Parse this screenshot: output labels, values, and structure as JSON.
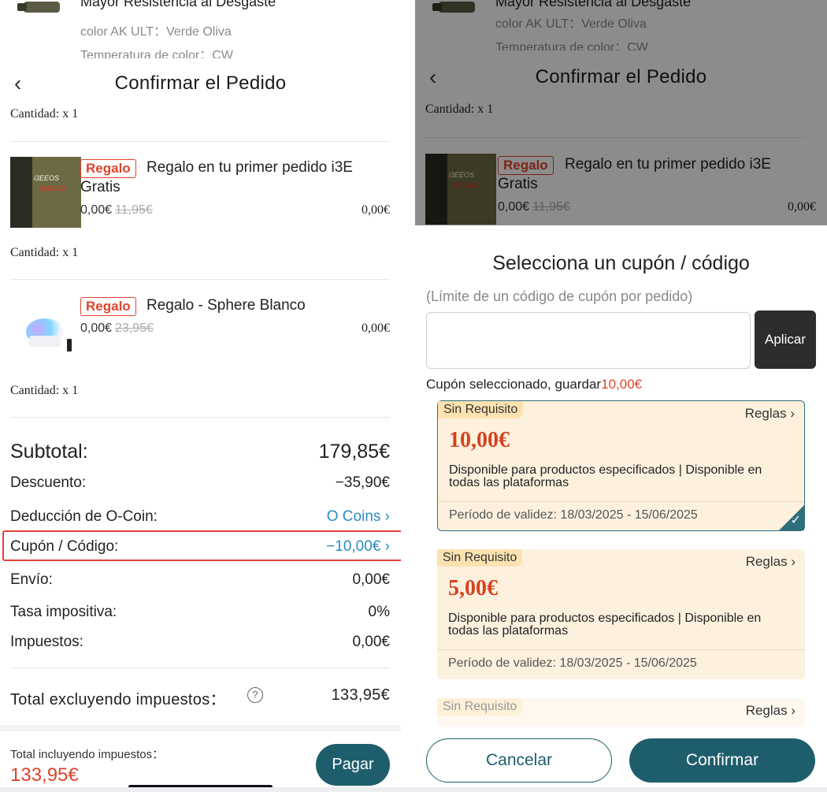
{
  "peek": {
    "line1": "Mayor Resistencia al Desgaste",
    "line2": "color AK ULT：Verde Oliva",
    "line3": "Temperatura de color：CW"
  },
  "header": {
    "title": "Confirmar el Pedido",
    "back": "‹"
  },
  "qty_label": "Cantidad: x 1",
  "items": [
    {
      "badge": "Regalo",
      "name1": "Regalo en tu primer pedido i3E",
      "name2": "Gratis",
      "price": "0,00€",
      "old_price": "11,95€",
      "amount": "0,00€"
    },
    {
      "badge": "Regalo",
      "name1": "Regalo - Sphere Blanco",
      "price": "0,00€",
      "old_price": "23,95€",
      "amount": "0,00€"
    }
  ],
  "summary": {
    "subtotal_label": "Subtotal:",
    "subtotal": "179,85€",
    "discount_label": "Descuento:",
    "discount": "−35,90€",
    "ocoin_label": "Deducción de O-Coin:",
    "ocoin": "O Coins ›",
    "coupon_label": "Cupón / Código:",
    "coupon": "−10,00€ ›",
    "shipping_label": "Envío:",
    "shipping": "0,00€",
    "taxrate_label": "Tasa impositiva:",
    "taxrate": "0%",
    "taxes_label": "Impuestos:",
    "taxes": "0,00€",
    "total_ex_label": "Total excluyendo impuestos：",
    "total_ex": "133,95€"
  },
  "footer": {
    "label": "Total incluyendo impuestos：",
    "total": "133,95€",
    "pay": "Pagar"
  },
  "giftbox_text": "i3EEOS",
  "giftbox_red": "REGALO",
  "sheet": {
    "title": "Selecciona un cupón / código",
    "hint": "(Límite de un código de cupón por pedido)",
    "input_placeholder": "",
    "apply": "Aplicar",
    "selected_prefix": "Cupón seleccionado, guardar",
    "selected_amount": "10,00€",
    "cancel": "Cancelar",
    "confirm": "Confirmar"
  },
  "coupons": [
    {
      "tag": "Sin Requisito",
      "rules": "Reglas ›",
      "value": "10,00€",
      "desc": "Disponible para productos especificados | Disponible en todas las plataformas",
      "valid": "Período de validez: 18/03/2025 - 15/06/2025"
    },
    {
      "tag": "Sin Requisito",
      "rules": "Reglas ›",
      "value": "5,00€",
      "desc": "Disponible para productos especificados | Disponible en todas las plataformas",
      "valid": "Período de validez: 18/03/2025 - 15/06/2025"
    },
    {
      "tag": "Sin Requisito",
      "rules": "Reglas ›"
    }
  ],
  "colors": {
    "accent": "#1e5e6c",
    "price_red": "#e0432a",
    "link_blue": "#2b8cc4",
    "coupon_bg": "#fdf1de"
  }
}
